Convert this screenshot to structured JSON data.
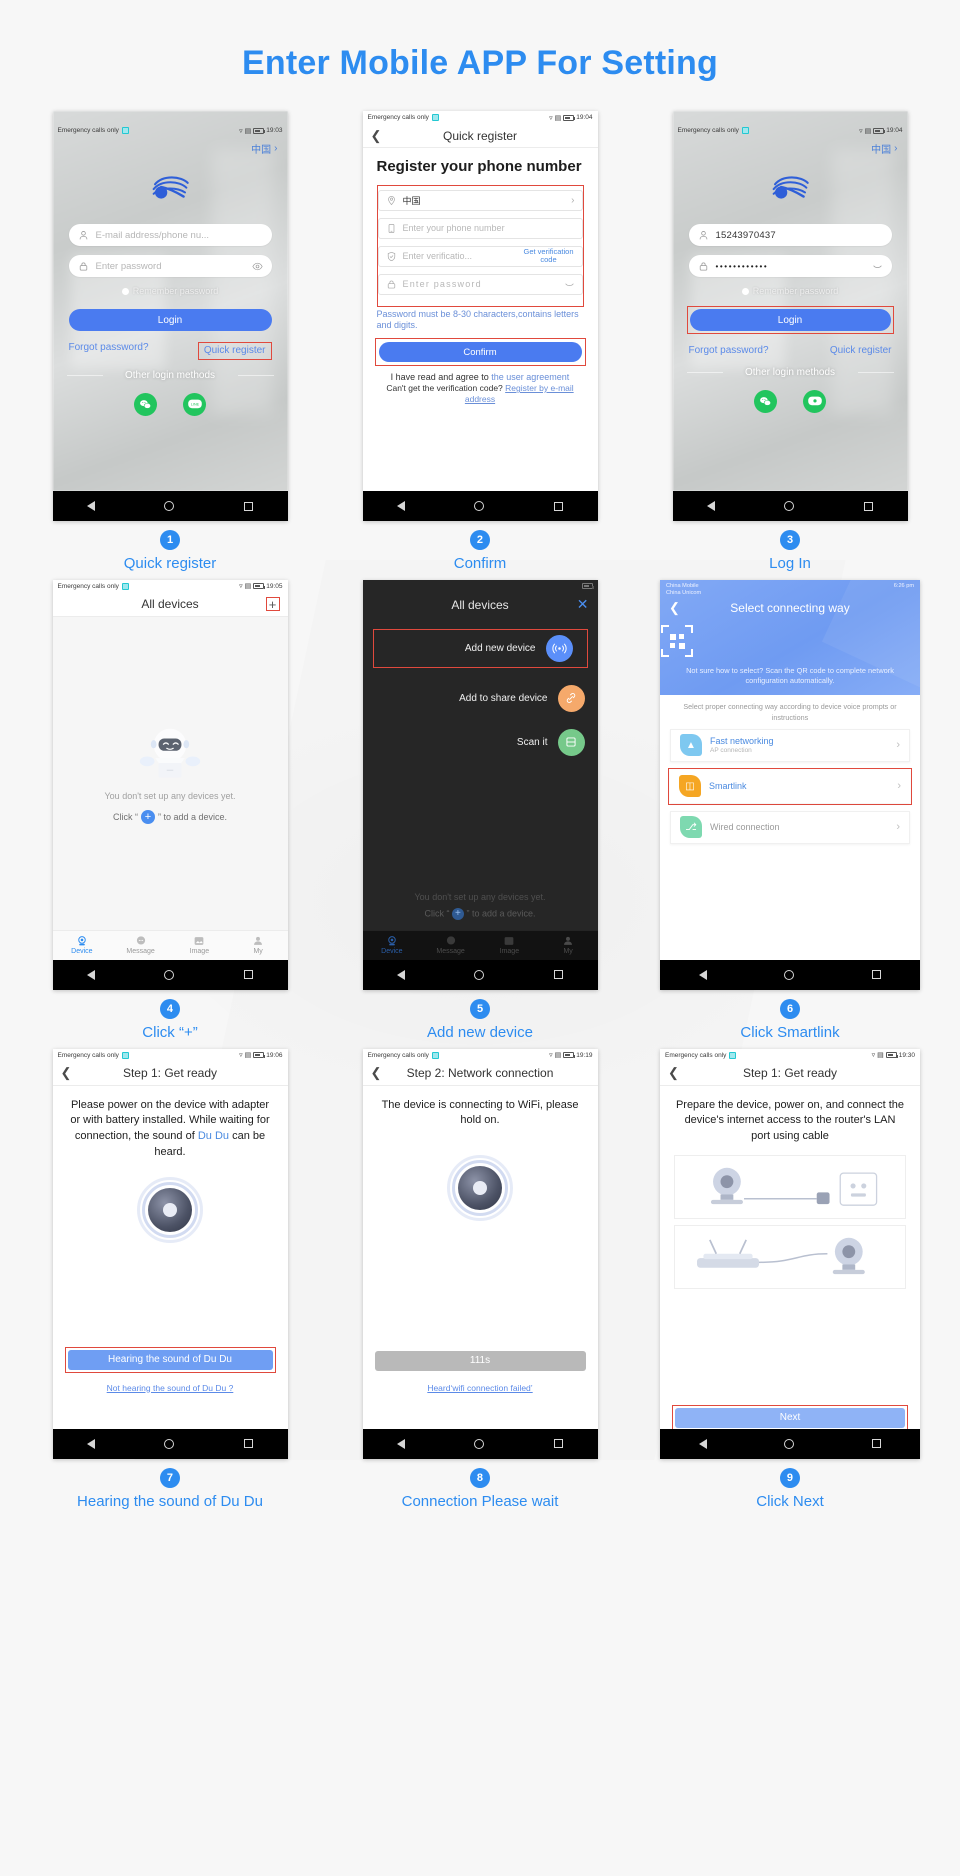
{
  "title": "Enter Mobile APP For Setting",
  "accent": "#2d8cf0",
  "highlight": "#e0493d",
  "common": {
    "carrier": "Emergency calls only",
    "nav_back": "◁",
    "nav_home": "○",
    "nav_recent": "□"
  },
  "steps": [
    {
      "num": "1",
      "caption": "Quick register",
      "time": "19:03",
      "country": "中国",
      "email_placeholder": "E-mail address/phone nu...",
      "password_placeholder": "Enter  password",
      "remember": "Remember password",
      "login": "Login",
      "forgot": "Forgot password?",
      "quick_register": "Quick register",
      "other_methods": "Other login methods",
      "social1": "wechat-icon",
      "social2": "LINE"
    },
    {
      "num": "2",
      "caption": "Confirm",
      "time": "19:04",
      "header": "Quick register",
      "h1": "Register your phone number",
      "country": "中国",
      "phone_placeholder": "Enter your phone number",
      "code_placeholder": "Enter verificatio...",
      "get_code": "Get verification code",
      "password_placeholder": "Enter  password",
      "pwd_note": "Password must be 8-30 characters,contains letters and digits.",
      "confirm": "Confirm",
      "agree_pre": "I have read and agree to",
      "agree_link": "the user agreement",
      "cant_pre": "Can't get the verification code?",
      "cant_link": "Register by e-mail address"
    },
    {
      "num": "3",
      "caption": "Log In",
      "time": "19:04",
      "country": "中国",
      "phone_value": "15243970437",
      "password_dots": "••••••••••••",
      "remember": "Remember password",
      "login": "Login",
      "forgot": "Forgot password?",
      "quick_register": "Quick register",
      "other_methods": "Other login methods"
    },
    {
      "num": "4",
      "caption": "Click “+”",
      "time": "19:05",
      "header": "All devices",
      "plus": "+",
      "empty_text": "You don't set up any devices yet.",
      "click_pre": "Click “",
      "click_post": "” to add a device.",
      "tabs": [
        {
          "label": "Device",
          "icon": "camera-icon",
          "active": true
        },
        {
          "label": "Message",
          "icon": "message-icon",
          "active": false
        },
        {
          "label": "Image",
          "icon": "image-icon",
          "active": false
        },
        {
          "label": "My",
          "icon": "person-icon",
          "active": false
        }
      ]
    },
    {
      "num": "5",
      "caption": "Add new device",
      "header": "All devices",
      "close": "✕",
      "options": [
        {
          "label": "Add new device",
          "icon": "signal-icon",
          "color": "#5b8ff9"
        },
        {
          "label": "Add to share device",
          "icon": "link-icon",
          "color": "#f5a96b"
        },
        {
          "label": "Scan it",
          "icon": "scan-icon",
          "color": "#76c98a"
        }
      ],
      "ghost_empty": "You don't set up any devices yet.",
      "ghost_click_pre": "Click “",
      "ghost_click_post": "” to add a device.",
      "tabs": [
        {
          "label": "Device",
          "active": true
        },
        {
          "label": "Message",
          "active": false
        },
        {
          "label": "Image",
          "active": false
        },
        {
          "label": "My",
          "active": false
        }
      ]
    },
    {
      "num": "6",
      "caption": "Click Smartlink",
      "time": "6:26 pm",
      "carrier1": "China Mobile",
      "carrier2": "China Unicom",
      "header": "Select connecting way",
      "qr_note": "Not sure how to select? Scan the QR code to complete network configuration automatically.",
      "subtitle": "Select proper connecting way according to device voice prompts or instructions",
      "ways": [
        {
          "title": "Fast networking",
          "sub": "AP connection",
          "icon": "rocket-icon",
          "color": "#7ec8f0",
          "highlighted": false
        },
        {
          "title": "Smartlink",
          "sub": "",
          "icon": "wifi-box-icon",
          "color": "#f5a623",
          "highlighted": true
        },
        {
          "title": "Wired connection",
          "sub": "",
          "icon": "plug-icon",
          "color": "#7ed9b0",
          "highlighted": false
        }
      ]
    },
    {
      "num": "7",
      "caption": "Hearing the sound of Du Du",
      "time": "19:06",
      "header": "Step 1: Get ready",
      "body_pre": "Please power on the device with adapter or with battery installed. While waiting for connection, the sound of ",
      "body_du": "Du Du",
      "body_post": " can be heard.",
      "button": "Hearing the sound of Du Du",
      "link": "Not hearing the sound of Du Du ?"
    },
    {
      "num": "8",
      "caption": "Connection Please wait",
      "time": "19:19",
      "header": "Step 2: Network connection",
      "body": "The device is connecting to WiFi, please hold on.",
      "button": "111s",
      "link": "Heard‘wifi connection failed’"
    },
    {
      "num": "9",
      "caption": "Click Next",
      "time": "19:30",
      "header": "Step 1: Get ready",
      "body": "Prepare the device, power on, and connect the device's internet access to the router's LAN port using cable",
      "button": "Next"
    }
  ]
}
